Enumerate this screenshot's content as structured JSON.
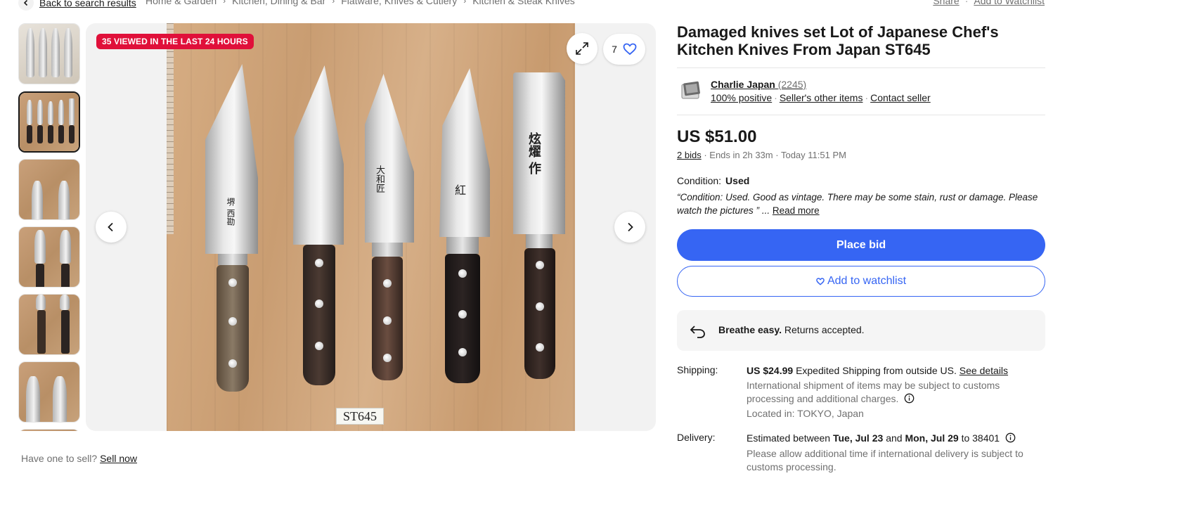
{
  "breadcrumb": {
    "back_label": "Back to search results",
    "items": [
      "Home & Garden",
      "Kitchen, Dining & Bar",
      "Flatware, Knives & Cutlery",
      "Kitchen & Steak Knives"
    ],
    "share_label": "Share",
    "add_watchlist_label": "Add to Watchlist"
  },
  "gallery": {
    "badge": "35 VIEWED IN THE LAST 24 HOURS",
    "watch_count": "7",
    "selected_thumb": 1,
    "tag_text": "ST645",
    "kanji": [
      "堺 西勘",
      "大和匠",
      "紅",
      "炫燿 作"
    ]
  },
  "sell": {
    "question": "Have one to sell?",
    "link": "Sell now"
  },
  "listing": {
    "title": "Damaged knives set Lot of Japanese Chef's Kitchen Knives From Japan ST645",
    "seller": {
      "name": "Charlie Japan",
      "count": "(2245)",
      "positive": "100% positive",
      "other_items": "Seller's other items",
      "contact": "Contact seller"
    },
    "price": "US $51.00",
    "bids": "2 bids",
    "ends": "Ends in 2h 33m",
    "ends_time": "Today 11:51 PM",
    "condition_label": "Condition:",
    "condition_value": "Used",
    "condition_quote": "“Condition: Used. Good as vintage. There may be some stain, rust or damage. Please watch the pictures ”",
    "read_more": "Read more",
    "place_bid": "Place bid",
    "add_to_watchlist": "Add to watchlist",
    "returns_bold": "Breathe easy.",
    "returns_text": "Returns accepted.",
    "shipping": {
      "label": "Shipping:",
      "price": "US $24.99",
      "method": "Expedited Shipping from outside US.",
      "see_details": "See details",
      "note": "International shipment of items may be subject to customs processing and additional charges.",
      "location": "Located in: TOKYO, Japan"
    },
    "delivery": {
      "label": "Delivery:",
      "prefix": "Estimated between",
      "date1": "Tue, Jul 23",
      "and": "and",
      "date2": "Mon, Jul 29",
      "to": "to",
      "zip": "38401",
      "note": "Please allow additional time if international delivery is subject to customs processing."
    }
  },
  "colors": {
    "accent": "#3665f3",
    "badge": "#e0103a",
    "text": "#191919",
    "muted": "#707070"
  }
}
